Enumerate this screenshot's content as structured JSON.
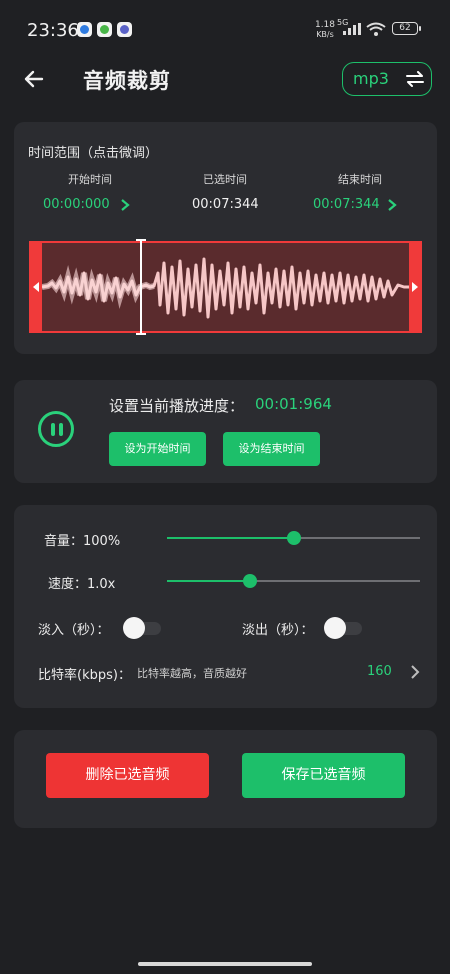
{
  "status_bar": {
    "time": "23:36",
    "net_speed": "1.18",
    "net_unit": "KB/s",
    "network": "5G",
    "battery": "62"
  },
  "header": {
    "title": "音频裁剪",
    "format": "mp3"
  },
  "range": {
    "title": "时间范围（点击微调）",
    "start_label": "开始时间",
    "start_value": "00:00:000",
    "selected_label": "已选时间",
    "selected_value": "00:07:344",
    "end_label": "结束时间",
    "end_value": "00:07:344"
  },
  "playback": {
    "label": "设置当前播放进度：",
    "value": "00:01:964",
    "set_start_button": "设为开始时间",
    "set_end_button": "设为结束时间"
  },
  "settings": {
    "volume_label": "音量：100%",
    "volume_level": 0.5,
    "speed_label": "速度：1.0x",
    "speed_level": 0.33,
    "fade_in_label": "淡入（秒）：",
    "fade_in_on": false,
    "fade_out_label": "淡出（秒）：",
    "fade_out_on": false,
    "bitrate_label": "比特率(kbps)：",
    "bitrate_hint": "比特率越高，音质越好",
    "bitrate_value": "160"
  },
  "actions": {
    "delete_button": "删除已选音频",
    "save_button": "保存已选音频"
  },
  "colors": {
    "accent": "#1dbf6a",
    "danger": "#ee3434",
    "background": "#1f2023",
    "card": "#2b2c30"
  }
}
